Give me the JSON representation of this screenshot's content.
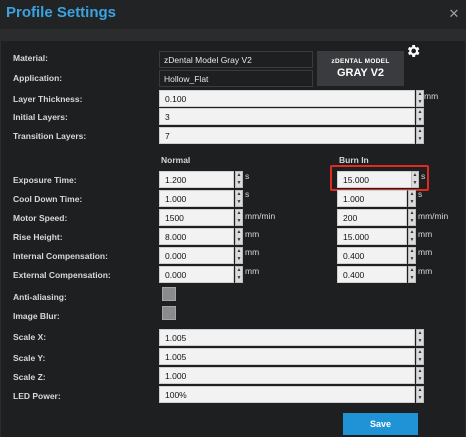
{
  "window": {
    "title": "Profile Settings",
    "close": "✕"
  },
  "labels": {
    "material": "Material:",
    "application": "Application:",
    "layer_thickness": "Layer Thickness:",
    "initial_layers": "Initial Layers:",
    "transition_layers": "Transition Layers:",
    "exposure_time": "Exposure Time:",
    "cool_down_time": "Cool Down Time:",
    "motor_speed": "Motor Speed:",
    "rise_height": "Rise Height:",
    "internal_compensation": "Internal Compensation:",
    "external_compensation": "External Compensation:",
    "anti_aliasing": "Anti-aliasing:",
    "image_blur": "Image Blur:",
    "scale_x": "Scale X:",
    "scale_y": "Scale Y:",
    "scale_z": "Scale Z:",
    "led_power": "LED Power:"
  },
  "columns": {
    "normal": "Normal",
    "burn_in": "Burn In"
  },
  "values": {
    "material": "zDental Model Gray V2",
    "application": "Hollow_Flat",
    "layer_thickness": "0.100",
    "initial_layers": "3",
    "transition_layers": "7",
    "normal": {
      "exposure_time": "1.200",
      "cool_down_time": "1.000",
      "motor_speed": "1500",
      "rise_height": "8.000",
      "internal_compensation": "0.000",
      "external_compensation": "0.000"
    },
    "burn_in": {
      "exposure_time": "15.000",
      "cool_down_time": "1.000",
      "motor_speed": "200",
      "rise_height": "15.000",
      "internal_compensation": "0.400",
      "external_compensation": "0.400"
    },
    "scale_x": "1.005",
    "scale_y": "1.005",
    "scale_z": "1.000",
    "led_power": "100%"
  },
  "units": {
    "layer_thickness": "mm",
    "exposure_time": "s",
    "cool_down_time": "s",
    "motor_speed": "mm/min",
    "rise_height": "mm",
    "internal_compensation": "mm",
    "external_compensation": "mm"
  },
  "logo": {
    "line1": "zDENTAL MODEL",
    "line2": "GRAY V2"
  },
  "icons": {
    "settings": "gear-icon",
    "spin_up": "▲",
    "spin_down": "▼"
  },
  "buttons": {
    "save": "Save"
  },
  "colors": {
    "accent": "#1f93d6",
    "highlight": "#e02b20",
    "title": "#3aa3e0"
  }
}
